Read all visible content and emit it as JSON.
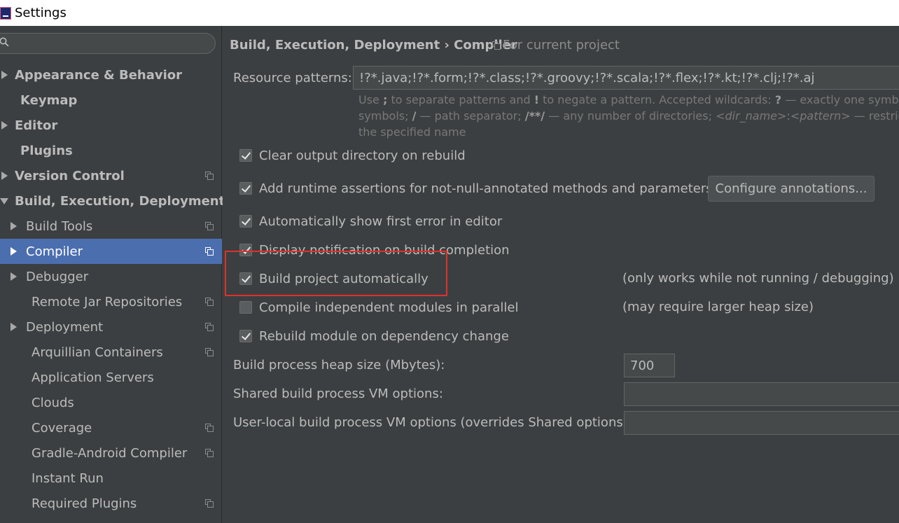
{
  "window": {
    "title": "Settings"
  },
  "sidebar": {
    "search_placeholder": "",
    "items": [
      {
        "label": "Appearance & Behavior"
      },
      {
        "label": "Keymap"
      },
      {
        "label": "Editor"
      },
      {
        "label": "Plugins"
      },
      {
        "label": "Version Control"
      },
      {
        "label": "Build, Execution, Deployment"
      },
      {
        "label": "Build Tools"
      },
      {
        "label": "Compiler"
      },
      {
        "label": "Debugger"
      },
      {
        "label": "Remote Jar Repositories"
      },
      {
        "label": "Deployment"
      },
      {
        "label": "Arquillian Containers"
      },
      {
        "label": "Application Servers"
      },
      {
        "label": "Clouds"
      },
      {
        "label": "Coverage"
      },
      {
        "label": "Gradle-Android Compiler"
      },
      {
        "label": "Instant Run"
      },
      {
        "label": "Required Plugins"
      }
    ]
  },
  "main": {
    "breadcrumb": "Build, Execution, Deployment › Compiler",
    "scope_note": "For current project",
    "resource_patterns": {
      "label": "Resource patterns:",
      "value": "!?*.java;!?*.form;!?*.class;!?*.groovy;!?*.scala;!?*.flex;!?*.kt;!?*.clj;!?*.aj"
    },
    "hint": {
      "l1a": "Use ",
      "l1b": ";",
      "l1c": " to separate patterns and ",
      "l1d": "!",
      "l1e": " to negate a pattern. Accepted wildcards: ",
      "l1f": "?",
      "l1g": " — exactly one symbol;",
      "l2a": "symbols; ",
      "l2b": "/",
      "l2c": " — path separator; ",
      "l2d": "/**/",
      "l2e": " — any number of directories; ",
      "l2f": "<dir_name>",
      "l2g": ":",
      "l2h": "<pattern>",
      "l2i": " — restricts",
      "l3": "the specified name"
    },
    "options": [
      {
        "label": "Clear output directory on rebuild",
        "checked": true
      },
      {
        "label": "Add runtime assertions for not-null-annotated methods and parameters",
        "checked": true
      },
      {
        "label": "Automatically show first error in editor",
        "checked": true
      },
      {
        "label": "Display notification on build completion",
        "checked": true
      },
      {
        "label": "Build project automatically",
        "checked": true
      },
      {
        "label": "Compile independent modules in parallel",
        "checked": false
      },
      {
        "label": "Rebuild module on dependency change",
        "checked": true
      }
    ],
    "configure_button": "Configure annotations...",
    "notes": {
      "build_auto": "(only works while not running / debugging)",
      "parallel": "(may require larger heap size)"
    },
    "heap_size": {
      "label": "Build process heap size (Mbytes):",
      "value": "700"
    },
    "shared_vm": {
      "label": "Shared build process VM options:",
      "value": ""
    },
    "user_vm": {
      "label": "User-local build process VM options (overrides Shared options):",
      "value": ""
    }
  }
}
